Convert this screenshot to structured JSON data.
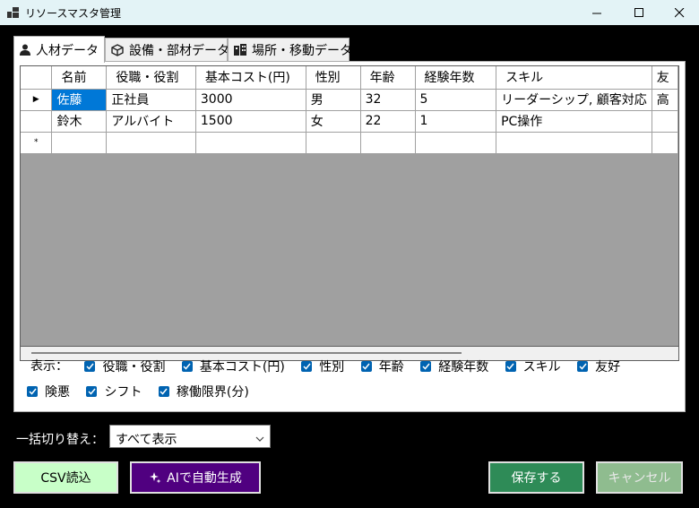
{
  "window": {
    "title": "リソースマスタ管理",
    "controls": {
      "minimize": "—",
      "maximize": "☐",
      "close": "✕"
    }
  },
  "tabs": [
    {
      "label": "人材データ",
      "icon": "person-icon",
      "active": true
    },
    {
      "label": "設備・部材データ",
      "icon": "cube-icon",
      "active": false
    },
    {
      "label": "場所・移動データ",
      "icon": "building-icon",
      "active": false
    }
  ],
  "grid": {
    "columns": [
      "名前",
      "役職・役割",
      "基本コスト(円)",
      "性別",
      "年齢",
      "経験年数",
      "スキル",
      "友"
    ],
    "rows": [
      {
        "marker": "▶",
        "cells": [
          "佐藤",
          "正社員",
          "3000",
          "男",
          "32",
          "5",
          "リーダーシップ, 顧客対応",
          "高"
        ]
      },
      {
        "marker": "",
        "cells": [
          "鈴木",
          "アルバイト",
          "1500",
          "女",
          "22",
          "1",
          "PC操作",
          ""
        ]
      },
      {
        "marker": "*",
        "cells": [
          "",
          "",
          "",
          "",
          "",
          "",
          "",
          ""
        ]
      }
    ],
    "selected_cell": "佐藤"
  },
  "display_options": {
    "label": "表示：",
    "items": [
      {
        "label": "役職・役割",
        "checked": true
      },
      {
        "label": "基本コスト(円)",
        "checked": true
      },
      {
        "label": "性別",
        "checked": true
      },
      {
        "label": "年齢",
        "checked": true
      },
      {
        "label": "経験年数",
        "checked": true
      },
      {
        "label": "スキル",
        "checked": true
      },
      {
        "label": "友好",
        "checked": true
      },
      {
        "label": "険悪",
        "checked": true
      },
      {
        "label": "シフト",
        "checked": true
      },
      {
        "label": "稼働限界(分)",
        "checked": true
      }
    ]
  },
  "bulk_toggle": {
    "label": "一括切り替え：",
    "selected": "すべて表示"
  },
  "buttons": {
    "csv": "CSV読込",
    "ai": "AIで自動生成",
    "save": "保存する",
    "cancel": "キャンセル"
  },
  "colors": {
    "selection": "#0078d7",
    "checkbox": "#0063b1",
    "csv_button": "#c8ffc8",
    "ai_button": "#500080",
    "save_button": "#2e8b57",
    "cancel_button": "#8fbc8f"
  }
}
